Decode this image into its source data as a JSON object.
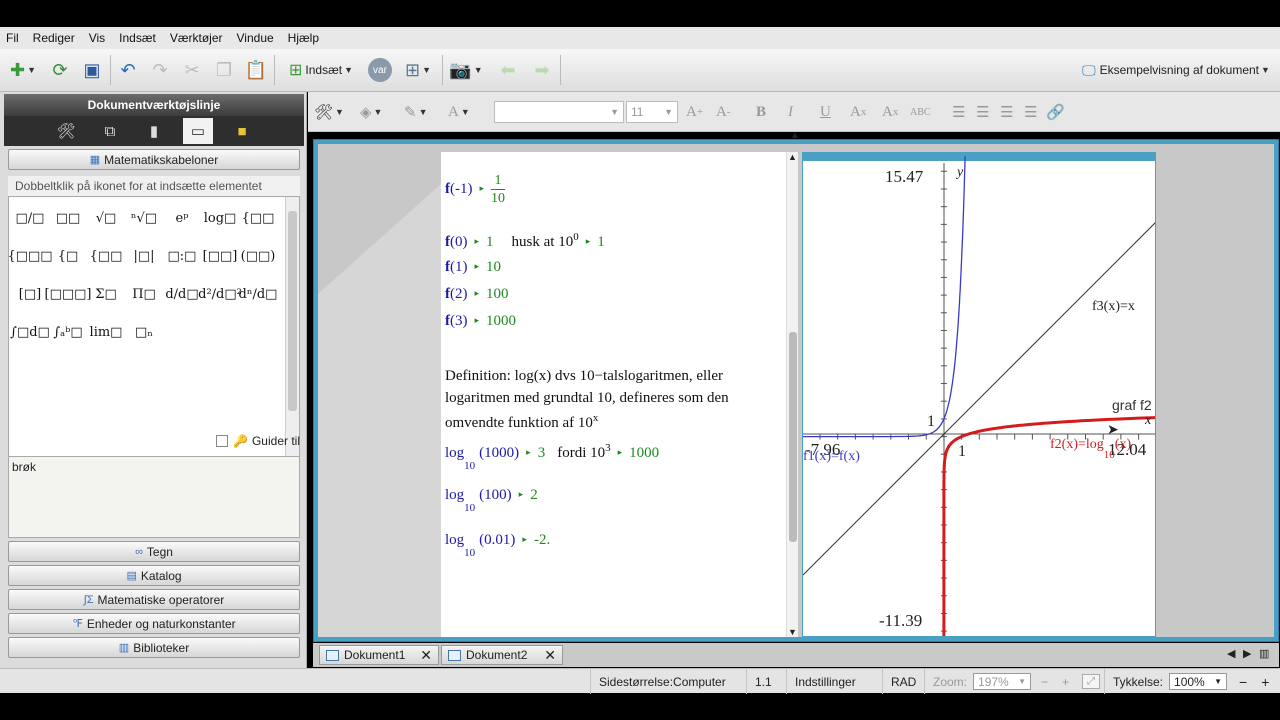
{
  "menu": [
    "Fil",
    "Rediger",
    "Vis",
    "Indsæt",
    "Værktøjer",
    "Vindue",
    "Hjælp"
  ],
  "toolbar": {
    "insert_label": "Indsæt",
    "var_label": "var",
    "preview_label": "Eksempelvisning af dokument"
  },
  "format": {
    "font_size": "11",
    "bold": "B",
    "italic": "I",
    "underline": "U",
    "abc": "ABC"
  },
  "left_panel": {
    "title": "Dokumentværktøjslinje",
    "section": "Matematikskabeloner",
    "hint": "Dobbeltklik på ikonet for at indsætte elementet",
    "templates": [
      "□/□",
      "□□",
      "√□",
      "ⁿ√□",
      "eᵖ",
      "log□",
      "{□□",
      "{□□□",
      "{□",
      "{□□",
      "|□|",
      "□:□",
      "[□□]",
      "(□□)",
      "[□]",
      "[□□□]",
      "Σ□",
      "Π□",
      "d/d□",
      "d²/d□²",
      "dⁿ/d□",
      "∫□d□",
      "∫ₐᵇ□",
      "lim□",
      "□ₙ"
    ],
    "guide": "Guider til",
    "description": "brøk",
    "accordions": [
      "Tegn",
      "Katalog",
      "Matematiske operatorer",
      "Enheder og naturkonstanter",
      "Biblioteker"
    ]
  },
  "notes": {
    "l1_fn": "f",
    "l1_arg": "(-1)",
    "l1_num": "1",
    "l1_den": "10",
    "l2_fn": "f",
    "l2_arg": "(0)",
    "l2_res": "1",
    "l2_husk": "husk at 10",
    "l2_exp": "0",
    "l2_res2": "1",
    "l3_fn": "f",
    "l3_arg": "(1)",
    "l3_res": "10",
    "l4_fn": "f",
    "l4_arg": "(2)",
    "l4_res": "100",
    "l5_fn": "f",
    "l5_arg": "(3)",
    "l5_res": "1000",
    "def1": "Definition: log(x) dvs 10−talslogaritmen, eller",
    "def2": "logaritmen med grundtal 10, defineres som den",
    "def3": "omvendte funktion af 10",
    "def3_exp": "x",
    "log1_fn": "log",
    "log1_base": "10",
    "log1_arg": "(1000)",
    "log1_res": "3",
    "log1_fordi": "fordi 10",
    "log1_exp": "3",
    "log1_res2": "1000",
    "log2_fn": "log",
    "log2_base": "10",
    "log2_arg": "(100)",
    "log2_res": "2",
    "log3_fn": "log",
    "log3_base": "10",
    "log3_arg": "(0.01)",
    "log3_res": "-2."
  },
  "graph": {
    "ymax": "15.47",
    "ymin": "-11.39",
    "xmin": "-7.96",
    "xmax": "12.04",
    "ylabel": "y",
    "xlabel": "x",
    "tick_y": "1",
    "tick_x": "1",
    "f3": "f3(x)=x",
    "f2": "f2(x)=log",
    "f2_base": "10",
    "f2_arg": "(x)",
    "f1": "f1(x)=f(x)",
    "graf_f2": "graf f2"
  },
  "tabs": [
    "Dokument1",
    "Dokument2"
  ],
  "status": {
    "page_size": "Sidestørrelse:Computer",
    "page": "1.1",
    "settings": "Indstillinger",
    "mode": "RAD",
    "zoom_label": "Zoom:",
    "zoom": "197%",
    "thickness_label": "Tykkelse:",
    "thickness": "100%"
  },
  "colors": {
    "f1": "#3a3ac8",
    "f2": "#d41c1c",
    "f3": "#333333",
    "accent": "#4a9fc4"
  }
}
